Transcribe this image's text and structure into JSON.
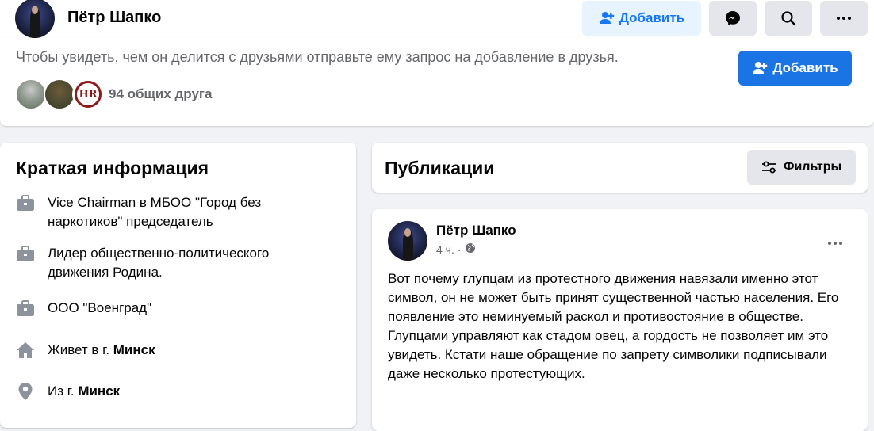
{
  "header": {
    "name": "Пётр Шапко",
    "add_label": "Добавить",
    "icons": [
      "messenger-icon",
      "search-icon",
      "more-icon"
    ]
  },
  "friend_request": {
    "message": "Чтобы увидеть, чем он делится с друзьями отправьте ему запрос на добавление в друзья.",
    "add_label": "Добавить",
    "mutual_friends_label": "94 общих друга",
    "mutual_avatar_3_text": "HR"
  },
  "intro": {
    "title": "Краткая информация",
    "items": [
      {
        "icon": "briefcase-icon",
        "text": "Vice Chairman в МБОО \"Город без наркотиков\" председатель",
        "bold": ""
      },
      {
        "icon": "briefcase-icon",
        "text": "Лидер общественно-политического движения Родина.",
        "bold": ""
      },
      {
        "icon": "briefcase-icon",
        "text": "ООО \"Военград\"",
        "bold": ""
      },
      {
        "icon": "home-icon",
        "text": "Живет в г. ",
        "bold": "Минск"
      },
      {
        "icon": "location-pin-icon",
        "text": "Из г. ",
        "bold": "Минск"
      }
    ]
  },
  "publications": {
    "title": "Публикации",
    "filter_label": "Фильтры"
  },
  "post": {
    "author": "Пётр Шапко",
    "time": "4 ч.",
    "audience_icon": "globe-icon",
    "text": "Вот почему глупцам из протестного движения навязали именно этот символ, он не может быть принят существенной частью населения. Его появление это неминуемый раскол и противостояние в обществе. Глупцами управляют как стадом овец, а гордость не позволяет им это увидеть. Кстати наше обращение по запрету символики подписывали даже несколько протестующих."
  },
  "colors": {
    "accent": "#1b74e4",
    "accent_light": "#e7f3ff",
    "secondary_text": "#65676b",
    "background": "#f0f2f5"
  }
}
